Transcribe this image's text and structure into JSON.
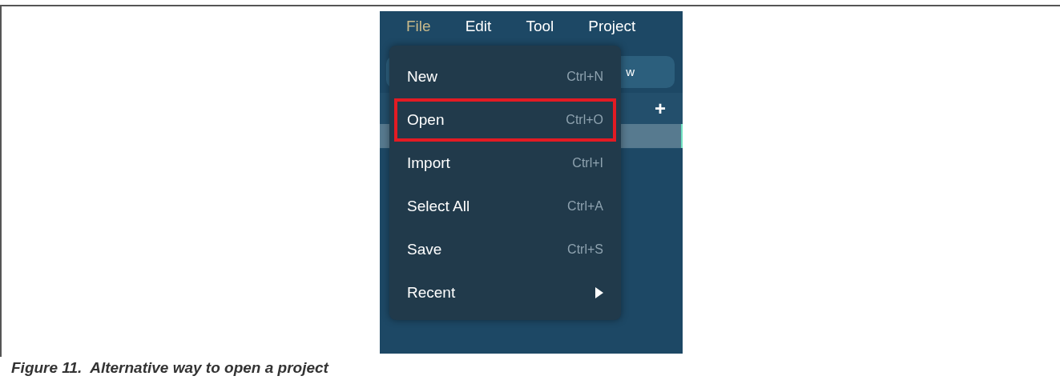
{
  "menu_bar": [
    {
      "label": "File",
      "selected": true
    },
    {
      "label": "Edit",
      "selected": false
    },
    {
      "label": "Tool",
      "selected": false
    },
    {
      "label": "Project",
      "selected": false
    }
  ],
  "background_tab": {
    "label": "w"
  },
  "panel": {
    "add_symbol": "+"
  },
  "file_menu": [
    {
      "kind": "command",
      "label": "New",
      "shortcut": "Ctrl+N",
      "highlighted": false
    },
    {
      "kind": "command",
      "label": "Open",
      "shortcut": "Ctrl+O",
      "highlighted": true
    },
    {
      "kind": "command",
      "label": "Import",
      "shortcut": "Ctrl+I",
      "highlighted": false
    },
    {
      "kind": "command",
      "label": "Select All",
      "shortcut": "Ctrl+A",
      "highlighted": false
    },
    {
      "kind": "command",
      "label": "Save",
      "shortcut": "Ctrl+S",
      "highlighted": false
    },
    {
      "kind": "submenu",
      "label": "Recent",
      "highlighted": false
    }
  ],
  "caption": "Figure 11.  Alternative way to open a project"
}
